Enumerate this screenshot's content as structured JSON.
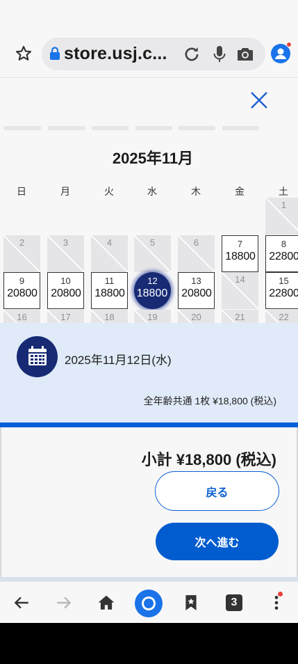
{
  "browser": {
    "url": "store.usj.c...",
    "accent": "#1a73e8"
  },
  "calendar": {
    "month_title": "2025年11月",
    "weekdays": [
      "日",
      "月",
      "火",
      "水",
      "木",
      "金",
      "土"
    ],
    "rows": [
      [
        null,
        null,
        null,
        null,
        null,
        null,
        {
          "day": "1",
          "price": "",
          "state": "disabled"
        }
      ],
      [
        {
          "day": "2",
          "price": "",
          "state": "disabled"
        },
        {
          "day": "3",
          "price": "",
          "state": "disabled"
        },
        {
          "day": "4",
          "price": "",
          "state": "disabled"
        },
        {
          "day": "5",
          "price": "",
          "state": "disabled"
        },
        {
          "day": "6",
          "price": "",
          "state": "disabled"
        },
        {
          "day": "7",
          "price": "18800",
          "state": "available"
        },
        {
          "day": "8",
          "price": "22800",
          "state": "available"
        }
      ],
      [
        {
          "day": "9",
          "price": "20800",
          "state": "available"
        },
        {
          "day": "10",
          "price": "20800",
          "state": "available"
        },
        {
          "day": "11",
          "price": "18800",
          "state": "available"
        },
        {
          "day": "12",
          "price": "18800",
          "state": "selected"
        },
        {
          "day": "13",
          "price": "20800",
          "state": "available"
        },
        {
          "day": "14",
          "price": "",
          "state": "disabled"
        },
        {
          "day": "15",
          "price": "22800",
          "state": "available"
        }
      ],
      [
        {
          "day": "16",
          "price": "",
          "state": "disabled"
        },
        {
          "day": "17",
          "price": "",
          "state": "disabled"
        },
        {
          "day": "18",
          "price": "",
          "state": "disabled"
        },
        {
          "day": "19",
          "price": "",
          "state": "disabled"
        },
        {
          "day": "20",
          "price": "",
          "state": "disabled"
        },
        {
          "day": "21",
          "price": "",
          "state": "disabled"
        },
        {
          "day": "22",
          "price": "",
          "state": "disabled"
        }
      ]
    ],
    "selected_color": "#172a73"
  },
  "summary": {
    "selected_date": "2025年11月12日(水)",
    "ticket_line": "全年齢共通 1枚 ¥18,800 (税込)"
  },
  "cart": {
    "subtotal": "小計 ¥18,800 (税込)",
    "back_label": "戻る",
    "next_label": "次へ進む",
    "primary_color": "#005ccf"
  },
  "bottom_nav": {
    "tab_count": "3"
  }
}
